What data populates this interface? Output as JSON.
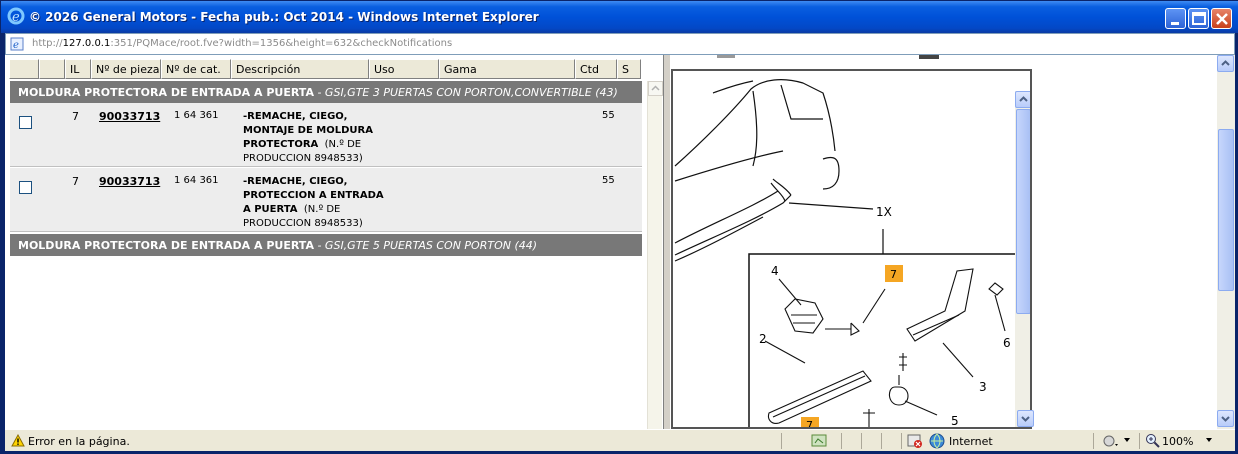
{
  "window": {
    "title": "© 2026 General Motors - Fecha pub.: Oct 2014 - Windows Internet Explorer",
    "address_prefix": "http://",
    "address_host": "127.0.0.1",
    "address_rest": ":351/PQMace/root.fve?width=1356&height=632&checkNotifications"
  },
  "table": {
    "headers": [
      "",
      "",
      "IL",
      "Nº de pieza",
      "Nº de cat.",
      "Descripción",
      "Uso",
      "Gama",
      "Ctd",
      "S"
    ],
    "sections": [
      {
        "title": "MOLDURA PROTECTORA DE ENTRADA A PUERTA",
        "subtitle": " - GSI,GTE 3 PUERTAS CON PORTON,CONVERTIBLE (43)",
        "rows": [
          {
            "il": "7",
            "part_number": "90033713",
            "cat_number": "1 64 361",
            "desc_bold": "-REMACHE, CIEGO, MONTAJE DE MOLDURA PROTECTORA",
            "desc_normal": "(N.º DE PRODUCCION 8948533)",
            "qty": "55"
          },
          {
            "il": "7",
            "part_number": "90033713",
            "cat_number": "1 64 361",
            "desc_bold": "-REMACHE, CIEGO, PROTECCION A ENTRADA A PUERTA",
            "desc_normal": "(N.º DE PRODUCCION 8948533)",
            "qty": "55"
          }
        ]
      },
      {
        "title": "MOLDURA PROTECTORA DE ENTRADA A PUERTA",
        "subtitle": " - GSI,GTE 5 PUERTAS CON PORTON (44)",
        "rows": []
      }
    ]
  },
  "diagram": {
    "callouts": [
      "1X",
      "2",
      "3",
      "4",
      "5",
      "6",
      "7",
      "7"
    ]
  },
  "status": {
    "message": "Error en la página.",
    "zone": "Internet",
    "zoom": "100%"
  }
}
